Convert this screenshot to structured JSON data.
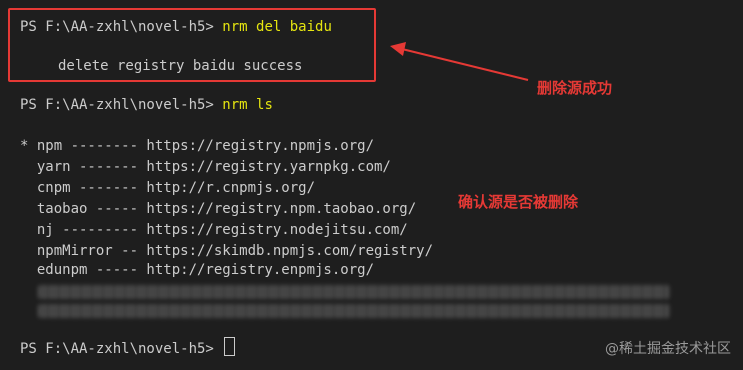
{
  "terminal": {
    "prompt": "PS F:\\AA-zxhl\\novel-h5> ",
    "command1": "nrm del baidu",
    "output1": "delete registry baidu success",
    "command2": "nrm ls",
    "registries": [
      "* npm -------- https://registry.npmjs.org/",
      "  yarn ------- https://registry.yarnpkg.com/",
      "  cnpm ------- http://r.cnpmjs.org/",
      "  taobao ----- https://registry.npm.taobao.org/",
      "  nj --------- https://registry.nodejitsu.com/",
      "  npmMirror -- https://skimdb.npmjs.com/registry/",
      "  edunpm ----- http://registry.enpmjs.org/"
    ]
  },
  "annotations": {
    "delete_success": "删除源成功",
    "confirm_deleted": "确认源是否被删除",
    "color": "#e53935"
  },
  "watermark": "@稀土掘金技术社区",
  "colors": {
    "background": "#1e1e1e",
    "text": "#cccccc",
    "command": "#e5e510"
  }
}
